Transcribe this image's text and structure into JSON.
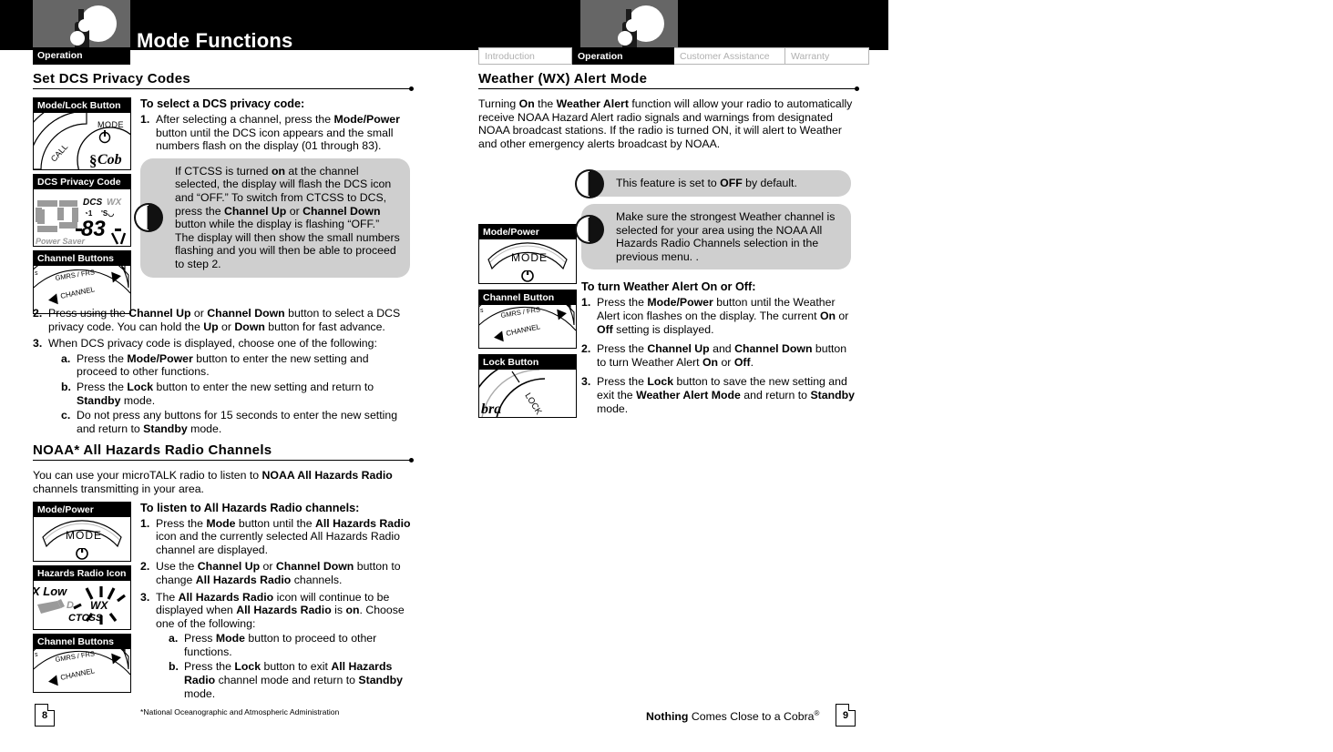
{
  "header": {
    "title": "Mode Functions",
    "logo_icon": "cobra-radio-person-icon",
    "section_label": "Operation"
  },
  "tabs": [
    {
      "label": "Introduction",
      "active": false
    },
    {
      "label": "Operation",
      "active": true
    },
    {
      "label": "Customer Assistance",
      "active": false
    },
    {
      "label": "Warranty",
      "active": false
    }
  ],
  "left_column": {
    "section1": {
      "heading": "Set DCS Privacy Codes",
      "figures": [
        {
          "caption": "Mode/Lock Button",
          "icon": "radio-dial-mode-lock-illustration"
        },
        {
          "caption": "DCS Privacy Code",
          "icon": "lcd-display-dcs-83-illustration"
        },
        {
          "caption": "Channel Buttons",
          "icon": "radio-dial-channel-arrows-illustration"
        }
      ],
      "list_title": "To select a DCS privacy code:",
      "step1_num": "1.",
      "step1_a": "After selecting a channel, press the ",
      "step1_b": "Mode/Power",
      "step1_c": " button until the DCS icon appears and the small numbers flash on the display (01 through 83).",
      "note": {
        "icon": "power-note-icon",
        "t1": "If CTCSS is turned ",
        "t2": "on",
        "t3": " at the channel selected, the display will flash the DCS icon and “OFF.” To switch from CTCSS to DCS, press the ",
        "t4": "Channel Up",
        "t5": " or ",
        "t6": "Channel Down",
        "t7": " button while the display is flashing “OFF.” The display will then show the small numbers flashing and you will then be able to proceed to step 2."
      },
      "step2_num": "2.",
      "step2_a": "Press using the ",
      "step2_b": "Channel Up",
      "step2_c": " or ",
      "step2_d": "Channel Down",
      "step2_e": " button to select a DCS privacy code. You can hold the ",
      "step2_f": "Up",
      "step2_g": " or ",
      "step2_h": "Down",
      "step2_i": " button for fast advance.",
      "step3_num": "3.",
      "step3_text": "When DCS privacy code is displayed, choose one of the following:",
      "step3a_num": "a.",
      "step3a_a": "Press the ",
      "step3a_b": "Mode/Power",
      "step3a_c": " button to enter the new setting and proceed to other functions.",
      "step3b_num": "b.",
      "step3b_a": "Press the ",
      "step3b_b": "Lock",
      "step3b_c": " button to enter the new setting and return to ",
      "step3b_d": "Standby",
      "step3b_e": " mode.",
      "step3c_num": "c.",
      "step3c_a": "Do not press any buttons for 15 seconds to enter the new setting and return to ",
      "step3c_b": "Standby",
      "step3c_c": " mode."
    },
    "section2": {
      "heading": "NOAA* All Hazards Radio Channels",
      "intro_a": "You can use your microTALK radio to listen to ",
      "intro_b": "NOAA All Hazards Radio",
      "intro_c": " channels transmitting in your area.",
      "figures": [
        {
          "caption": "Mode/Power",
          "icon": "mode-power-button-illustration"
        },
        {
          "caption": "Hazards Radio Icon",
          "icon": "lcd-wx-ctcss-icon-illustration"
        },
        {
          "caption": "Channel Buttons",
          "icon": "radio-dial-channel-arrows-illustration"
        }
      ],
      "list_title": "To listen to All Hazards Radio channels:",
      "step1_num": "1.",
      "step1_a": "Press the ",
      "step1_b": "Mode",
      "step1_c": " button until the ",
      "step1_d": "All Hazards Radio",
      "step1_e": " icon and the currently selected All Hazards Radio channel are displayed.",
      "step2_num": "2.",
      "step2_a": "Use the ",
      "step2_b": "Channel Up",
      "step2_c": " or ",
      "step2_d": "Channel Down",
      "step2_e": " button to change ",
      "step2_f": "All Hazards Radio",
      "step2_g": " channels.",
      "step3_num": "3.",
      "step3_a": "The ",
      "step3_b": "All Hazards Radio",
      "step3_c": " icon will continue to be displayed when ",
      "step3_d": "All Hazards Radio",
      "step3_e": " is ",
      "step3_f": "on",
      "step3_g": ". Choose one of the following:",
      "step3a_num": "a.",
      "step3a_a": "Press ",
      "step3a_b": "Mode",
      "step3a_c": " button to proceed to other functions.",
      "step3b_num": "b.",
      "step3b_a": "Press the ",
      "step3b_b": "Lock",
      "step3b_c": " button to exit ",
      "step3b_d": "All Hazards Radio",
      "step3b_e": " channel mode and return to ",
      "step3b_f": "Standby",
      "step3b_g": " mode.",
      "footnote": "*National Oceanographic and Atmospheric Administration"
    }
  },
  "right_column": {
    "section1": {
      "heading": "Weather (WX) Alert Mode",
      "intro_a": "Turning ",
      "intro_b": "On",
      "intro_c": " the ",
      "intro_d": "Weather Alert",
      "intro_e": " function will allow your radio to automatically receive NOAA Hazard Alert radio signals and warnings from designated NOAA broadcast stations.  If the radio is turned ON, it will alert to Weather and other emergency alerts broadcast by NOAA.",
      "note1": {
        "icon": "power-note-icon",
        "t1": "This feature is set to ",
        "t2": "OFF",
        "t3": " by default."
      },
      "note2": {
        "icon": "power-note-icon",
        "t1": "Make sure the strongest Weather channel is selected for your area using the NOAA All Hazards Radio Channels selection in the previous menu.  ."
      },
      "figures": [
        {
          "caption": "Mode/Power",
          "icon": "mode-power-button-illustration"
        },
        {
          "caption": "Channel Button",
          "icon": "radio-dial-channel-arrows-illustration"
        },
        {
          "caption": "Lock Button",
          "icon": "radio-dial-lock-illustration"
        }
      ],
      "list_title": "To turn Weather Alert On or Off:",
      "step1_num": "1.",
      "step1_a": "Press the ",
      "step1_b": "Mode/Power",
      "step1_c": " button until the Weather Alert icon flashes on the display.  The current ",
      "step1_d": "On",
      "step1_e": " or ",
      "step1_f": "Off",
      "step1_g": " setting is displayed.",
      "step2_num": "2.",
      "step2_a": "Press the ",
      "step2_b": "Channel Up",
      "step2_c": " and ",
      "step2_d": "Channel Down",
      "step2_e": " button to turn Weather Alert ",
      "step2_f": "On",
      "step2_g": " or ",
      "step2_h": "Off",
      "step2_i": ".",
      "step3_num": "3.",
      "step3_a": "Press the ",
      "step3_b": "Lock",
      "step3_c": " button to save the new setting and exit the ",
      "step3_d": "Weather Alert Mode",
      "step3_e": " and return to ",
      "step3_f": "Standby",
      "step3_g": " mode."
    }
  },
  "footer": {
    "page_left": "8",
    "page_right": "9",
    "tagline_bold": "Nothing",
    "tagline_rest": " Comes Close to a Cobra",
    "tagline_mark": "®"
  },
  "colors": {
    "header_bg": "#000000",
    "logo_bg": "#666666",
    "note_bg": "#cfcfcf",
    "tab_inactive_text": "#b0b0b0",
    "lcd_gray": "#9a9a9a"
  }
}
